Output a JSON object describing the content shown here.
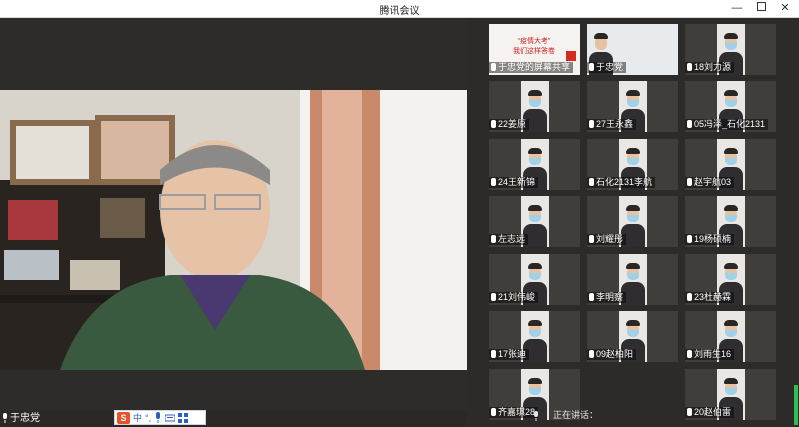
{
  "window": {
    "title": "腾讯会议",
    "buttons": [
      "—",
      "□",
      "✕"
    ]
  },
  "speaker": {
    "name": "于忠党"
  },
  "ime": {
    "logo": "S",
    "mode": "中"
  },
  "gallery": {
    "tiles": [
      {
        "label": "于忠党的屏幕共享",
        "kind": "share",
        "share_line1": "“疫情大考”",
        "share_line2": "我们这样答卷"
      },
      {
        "label": "于忠党",
        "kind": "wide"
      },
      {
        "label": "18刘力源"
      },
      {
        "label": "22姜原"
      },
      {
        "label": "27王永鑫"
      },
      {
        "label": "05冯泽_石化2131"
      },
      {
        "label": "24王新锦"
      },
      {
        "label": "石化2131李航"
      },
      {
        "label": "赵宇航03"
      },
      {
        "label": "左志远"
      },
      {
        "label": "刘耀彤"
      },
      {
        "label": "19杨硕楠"
      },
      {
        "label": "21刘伟峻"
      },
      {
        "label": "李明察"
      },
      {
        "label": "23杜赫霖"
      },
      {
        "label": "17张迪"
      },
      {
        "label": "09赵柏阳"
      },
      {
        "label": "刘雨生16"
      },
      {
        "label": "齐嘉琪28"
      },
      {
        "label": ""
      },
      {
        "label": "20赵伯雷"
      }
    ]
  },
  "status": {
    "speaking_label": "正在讲话："
  }
}
